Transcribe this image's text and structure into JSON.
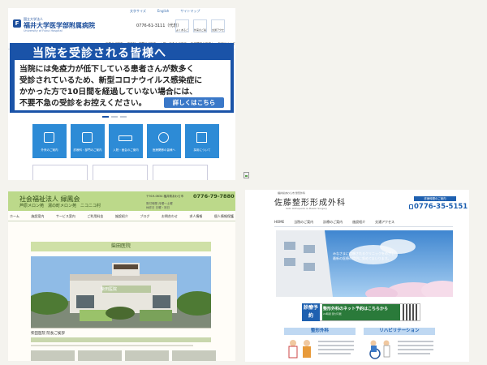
{
  "panel_a": {
    "top_links": [
      "文字サイズ",
      "English",
      "サイトマップ"
    ],
    "logo_sub": "国立大学法人",
    "logo_name": "福井大学医学部附属病院",
    "logo_en": "University of Fukui Hospital",
    "phone": "0776-61-3111（代表）",
    "top_icons": [
      "よくあるご質問",
      "外来のご案内",
      "交通アクセス"
    ],
    "nav": [
      "当院のご案内",
      "診療科・部門のご案内",
      "入院・面会のご案内",
      "医療関係の皆様へ",
      "採用について"
    ],
    "banner_title": "当院を受診される皆様へ",
    "banner_lines": [
      "当院には免疫力が低下している患者さんが数多く",
      "受診されているため、新型コロナウイルス感染症に",
      "かかった方で10日間を経過していない場合には、",
      "不要不急の受診をお控えください。"
    ],
    "detail_button": "詳しくはこちら",
    "tiles": [
      "外来のご案内",
      "診療科・部門のご案内",
      "入院・面会のご案内",
      "医療関係の皆様へ",
      "採用について"
    ]
  },
  "panel_b": {
    "corp_name": "社会福祉法人 緑鳳会",
    "facilities": "芦原メロン苑　湯の町メロン苑　ニコニコ村",
    "address": "〒919-0634 福井県あわら市",
    "phone": "0776-79-7880",
    "info_line_1": "受付時間 月曜〜土曜",
    "info_line_2": "休診日 日曜・祝日",
    "nav": [
      "ホーム",
      "施設案内",
      "サービス案内",
      "ご利用料金",
      "施設紹介",
      "ブログ",
      "お問合わせ",
      "求人情報",
      "個人情報保護"
    ],
    "section_title": "柴田医院",
    "sign_text": "柴田医院",
    "caption": "柴田医院 院長ご挨拶"
  },
  "panel_c": {
    "breadcrumb": "福井県あわら市 整形外科",
    "clinic_name": "佐藤整形形成外科",
    "clinic_en": "Sato Orthopedic & Plastic Surgery",
    "hours_label": "診療時間のご案内",
    "phone": "0776-35-5151",
    "nav": [
      "HOME",
      "当院のご案内",
      "診療のご案内",
      "施設紹介",
      "交通アクセス"
    ],
    "hero_line_1": "みなさまに信頼されるクリニックをめざし",
    "hero_line_2": "最新の医療の提供に努めてまいります。",
    "reserve_label": "診療予約",
    "reserve_title": "整形外科のネット予約はこちらから",
    "reserve_sub": "24時間 受付可能",
    "section_1": "整形外科",
    "section_2": "リハビリテーション"
  }
}
